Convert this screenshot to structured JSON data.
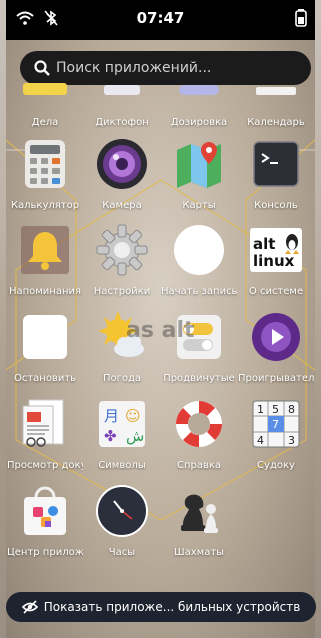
{
  "status": {
    "time": "07:47",
    "icons": [
      "wifi-icon",
      "bluetooth-off-icon",
      "battery-icon"
    ]
  },
  "search": {
    "placeholder": "Поиск приложений..."
  },
  "apps": [
    {
      "label": "Дела",
      "icon": "tasks-icon"
    },
    {
      "label": "Диктофон",
      "icon": "recorder-icon"
    },
    {
      "label": "Дозировка",
      "icon": "dosage-icon"
    },
    {
      "label": "Календарь",
      "icon": "calendar-icon"
    },
    {
      "label": "Калькулятор",
      "icon": "calculator-icon"
    },
    {
      "label": "Камера",
      "icon": "camera-icon"
    },
    {
      "label": "Карты",
      "icon": "maps-icon"
    },
    {
      "label": "Консоль",
      "icon": "terminal-icon"
    },
    {
      "label": "Напоминания",
      "icon": "bell-icon"
    },
    {
      "label": "Настройки",
      "icon": "gear-icon"
    },
    {
      "label": "Начать запись",
      "icon": "record-icon"
    },
    {
      "label": "О системе",
      "icon": "alt-linux-logo-icon"
    },
    {
      "label": "Остановить",
      "icon": "stop-icon"
    },
    {
      "label": "Погода",
      "icon": "weather-icon"
    },
    {
      "label": "Продвинутые",
      "icon": "toggles-icon"
    },
    {
      "label": "Проигрыватель",
      "icon": "player-icon"
    },
    {
      "label": "Просмотр документов",
      "icon": "document-viewer-icon"
    },
    {
      "label": "Символы",
      "icon": "characters-icon"
    },
    {
      "label": "Справка",
      "icon": "lifebuoy-icon"
    },
    {
      "label": "Судоку",
      "icon": "sudoku-icon"
    },
    {
      "label": "Центр приложений",
      "icon": "app-center-icon"
    },
    {
      "label": "Часы",
      "icon": "clock-icon"
    },
    {
      "label": "Шахматы",
      "icon": "chess-icon"
    }
  ],
  "logo": {
    "line1": "alt",
    "line2": "linux"
  },
  "sudoku_digits": [
    "1",
    "5",
    "8",
    "7",
    "4",
    "3"
  ],
  "characters_glyphs": [
    "月",
    "☺",
    "✤",
    "ش"
  ],
  "watermark": "as alt",
  "bottom_button": {
    "label": "Показать приложе... бильных устройств",
    "icon": "eye-off-icon"
  },
  "colors": {
    "statusbar": "#000000",
    "search_bg": "#1b1b1b",
    "bottom_bg": "#1e2330",
    "grid_lines": "#e3b94a"
  }
}
